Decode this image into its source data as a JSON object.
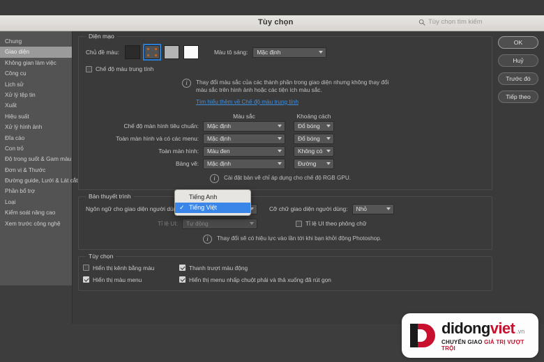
{
  "window": {
    "title": "Tùy chọn",
    "search_placeholder": "Tùy chọn tìm kiếm",
    "search_value": "",
    "search_icon": "search-icon"
  },
  "sidebar": {
    "items": [
      {
        "label": "Chung",
        "active": false
      },
      {
        "label": "Giao diện",
        "active": true
      },
      {
        "label": "Không gian làm việc",
        "active": false
      },
      {
        "label": "Công cụ",
        "active": false
      },
      {
        "label": "Lịch sử",
        "active": false
      },
      {
        "label": "Xử lý tệp tin",
        "active": false
      },
      {
        "label": "Xuất",
        "active": false
      },
      {
        "label": "Hiệu suất",
        "active": false
      },
      {
        "label": "Xử lý hình ảnh",
        "active": false
      },
      {
        "label": "Đĩa cào",
        "active": false
      },
      {
        "label": "Con trỏ",
        "active": false
      },
      {
        "label": "Độ trong suốt & Gam màu",
        "active": false
      },
      {
        "label": "Đơn vị & Thước",
        "active": false
      },
      {
        "label": "Đường guide, Lưới & Lát cắt",
        "active": false
      },
      {
        "label": "Phần bổ trợ",
        "active": false
      },
      {
        "label": "Loại",
        "active": false
      },
      {
        "label": "Kiểm soát nâng cao",
        "active": false
      },
      {
        "label": "Xem trước công nghệ",
        "active": false
      }
    ]
  },
  "appearance": {
    "legend": "Diện mạo",
    "color_theme_label": "Chủ đề màu:",
    "swatches": [
      {
        "name": "dark",
        "color": "#2b2b2b",
        "selected": false
      },
      {
        "name": "medium-dark",
        "color": "#535353",
        "selected": true
      },
      {
        "name": "light-gray",
        "color": "#b4b4b4",
        "selected": false
      },
      {
        "name": "white",
        "color": "#fafafa",
        "selected": false
      }
    ],
    "highlight_label": "Màu tô sáng:",
    "highlight_value": "Mặc định",
    "neutral_checkbox_label": "Chế độ màu trung tính",
    "neutral_checked": false,
    "info_text": "Thay đổi màu sắc của các thành phần trong giao diện nhưng không thay đổi màu sắc trên hình ảnh hoặc các tiện ích màu sắc.",
    "info_link": "Tìm hiểu thêm về Chế độ màu trung tính",
    "col_color": "Màu sắc",
    "col_border": "Khoảng cách",
    "rows": [
      {
        "label": "Chế độ màn hình tiêu chuẩn:",
        "color": "Mặc định",
        "border": "Đổ bóng"
      },
      {
        "label": "Toàn màn hình và có các menu:",
        "color": "Mặc định",
        "border": "Đổ bóng"
      },
      {
        "label": "Toàn màn hình:",
        "color": "Màu đen",
        "border": "Không có"
      },
      {
        "label": "Bảng vẽ:",
        "color": "Mặc định",
        "border": "Đường"
      }
    ],
    "gpu_note": "Cài đặt bản vẽ chỉ áp dụng cho chế độ RGB GPU."
  },
  "presentation": {
    "legend": "Bản thuyết trình",
    "language_label": "Ngôn ngữ cho giao diện người dùng:",
    "language_value": "Tiếng Việt",
    "fontsize_label": "Cỡ chữ giao diện người dùng:",
    "fontsize_value": "Nhỏ",
    "uiscale_label": "Tỉ lệ UI:",
    "uiscale_value": "Tự động",
    "uiscale_font_label": "Tỉ lệ UI theo phông chữ",
    "uiscale_font_checked": false,
    "restart_note": "Thay đổi sẽ có hiệu lực vào lần tới khi bạn khởi động Photoshop.",
    "dropdown_open": true,
    "dropdown_options": [
      {
        "label": "Tiếng Anh",
        "selected": false
      },
      {
        "label": "Tiếng Việt",
        "selected": true
      }
    ]
  },
  "options": {
    "legend": "Tùy chọn",
    "items": [
      {
        "label": "Hiển thị kênh bằng màu",
        "checked": false
      },
      {
        "label": "Thanh trượt màu động",
        "checked": true
      },
      {
        "label": "Hiển thị màu menu",
        "checked": true
      },
      {
        "label": "Hiển thị menu nhấp chuột phải và thả xuống đã rút gọn",
        "checked": true
      }
    ]
  },
  "buttons": {
    "ok": "OK",
    "cancel": "Huỷ",
    "prev": "Trước đó",
    "next": "Tiếp theo"
  },
  "watermark": {
    "brand_a": "didong",
    "brand_b": "viet",
    "tld": ".vn",
    "tag_a": "CHUYỂN GIAO ",
    "tag_b": "GIÁ TRỊ VƯỢT TRỘI"
  },
  "colors": {
    "accent_blue": "#3a86e8",
    "link_blue": "#3f8fe0",
    "brand_red": "#c8102e",
    "panel_bg": "#3a3a3a",
    "sidebar_bg": "#535353"
  }
}
